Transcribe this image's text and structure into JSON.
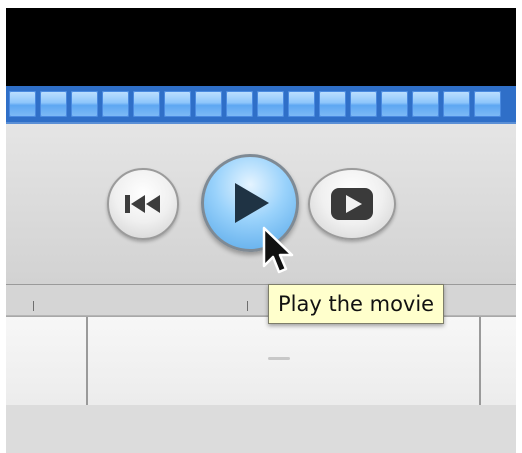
{
  "player": {
    "tooltip_text": "Play the movie",
    "buttons": [
      {
        "name": "rewind",
        "icon": "rewind-to-start-icon"
      },
      {
        "name": "play",
        "icon": "play-icon"
      },
      {
        "name": "play-fullscreen",
        "icon": "play-fullscreen-icon"
      }
    ],
    "cursor_icon": "mouse-pointer-icon"
  },
  "colors": {
    "timeline_blue": "#5ea7f2",
    "play_button_blue": "#55a6e8",
    "tooltip_bg": "#ffffcc",
    "viewer_bg": "#000000"
  }
}
